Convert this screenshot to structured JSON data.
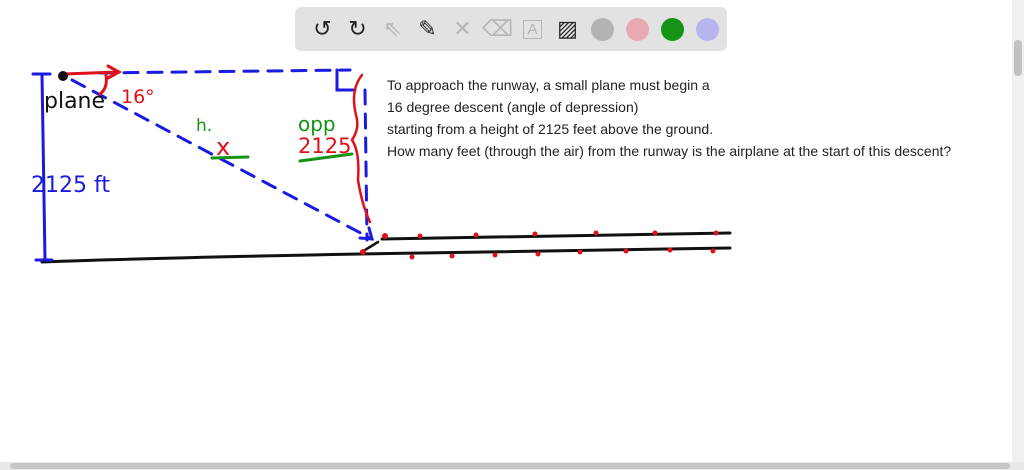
{
  "toolbar": {
    "tools": [
      {
        "name": "undo-icon",
        "glyph": "↺"
      },
      {
        "name": "redo-icon",
        "glyph": "↻"
      },
      {
        "name": "select-icon",
        "glyph": "⇖"
      },
      {
        "name": "pen-icon",
        "glyph": "✎"
      },
      {
        "name": "tools-icon",
        "glyph": "✕"
      },
      {
        "name": "eraser-icon",
        "glyph": "⌫"
      },
      {
        "name": "text-icon",
        "glyph": "A"
      },
      {
        "name": "image-icon",
        "glyph": "▨"
      }
    ],
    "colors": [
      "#b3b3b3",
      "#e9a9b3",
      "#149414",
      "#b8b4ee"
    ]
  },
  "problem": {
    "lines": [
      "To approach the runway, a small plane must begin a",
      "16 degree descent (angle of depression)",
      "starting from a height of 2125 feet above the ground.",
      "How many feet (through the air) from the runway is the airplane at the start of this descent?"
    ]
  },
  "sketch": {
    "plane_label": "plane",
    "angle_label": "16°",
    "height_label": "2125 ft",
    "hyp_label": "h.",
    "unknown_label": "x",
    "opp_label": "opp",
    "opp_value": "2125"
  }
}
